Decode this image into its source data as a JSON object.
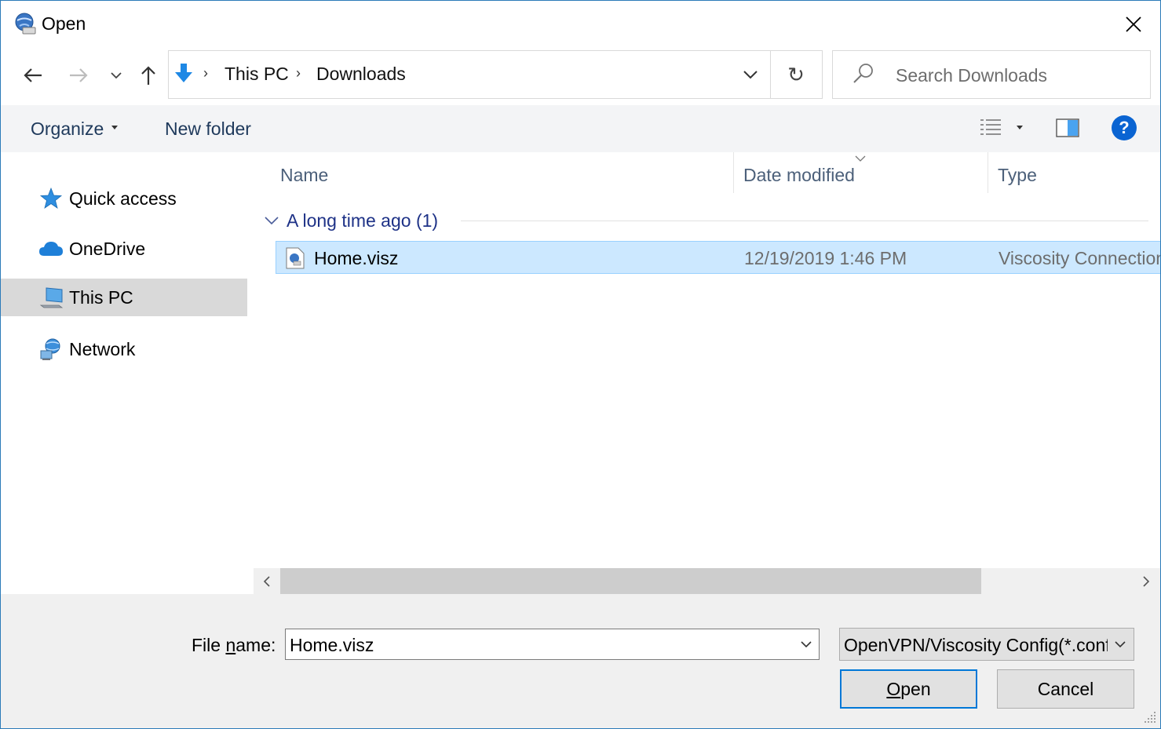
{
  "window": {
    "title": "Open",
    "close_glyph": "✕"
  },
  "address": {
    "breadcrumbs": [
      "This PC",
      "Downloads"
    ],
    "separator": "›",
    "refresh_glyph": "↻",
    "search_placeholder": "Search Downloads"
  },
  "toolbar": {
    "organize_label": "Organize",
    "new_folder_label": "New folder",
    "help_label": "?"
  },
  "nav": {
    "items": [
      {
        "label": "Quick access",
        "icon": "star-icon",
        "selected": false
      },
      {
        "label": "OneDrive",
        "icon": "cloud-icon",
        "selected": false
      },
      {
        "label": "This PC",
        "icon": "computer-icon",
        "selected": true
      },
      {
        "label": "Network",
        "icon": "network-icon",
        "selected": false
      }
    ]
  },
  "files": {
    "columns": [
      "Name",
      "Date modified",
      "Type"
    ],
    "group_label": "A long time ago (1)",
    "rows": [
      {
        "name": "Home.visz",
        "date": "12/19/2019 1:46 PM",
        "type": "Viscosity Connection"
      }
    ]
  },
  "bottom": {
    "file_name_label_pre": "File ",
    "file_name_label_u": "n",
    "file_name_label_post": "ame:",
    "file_name_value": "Home.visz",
    "filter_value": "OpenVPN/Viscosity Config(*.conf;*.ovpn;*.visz)",
    "open_label_u": "O",
    "open_label_rest": "pen",
    "cancel_label": "Cancel"
  },
  "colors": {
    "accent": "#0078d7",
    "selection": "#cce8ff",
    "selection_border": "#99d1ff",
    "group_text": "#1e3287"
  }
}
